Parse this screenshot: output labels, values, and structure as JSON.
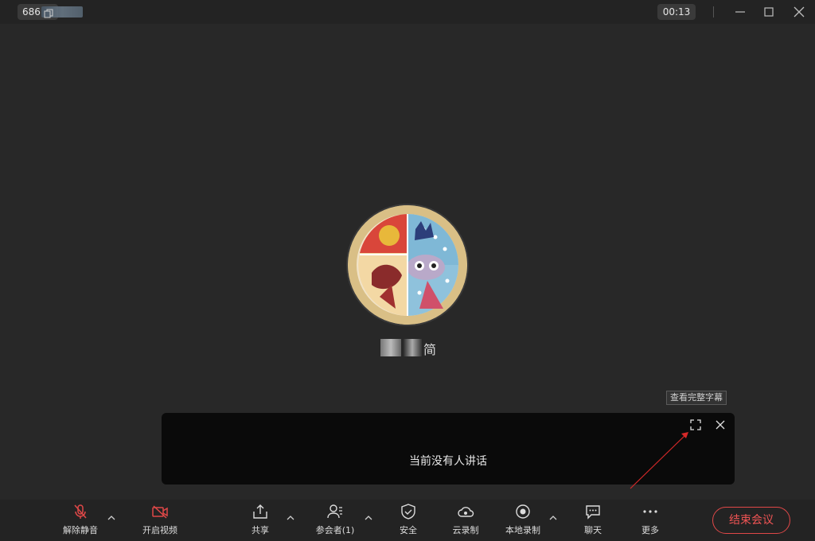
{
  "titlebar": {
    "meeting_id": "686",
    "timer": "00:13"
  },
  "profile": {
    "name_visible": "简"
  },
  "captions": {
    "full_captions_button": "查看完整字幕",
    "status_text": "当前没有人讲话"
  },
  "toolbar": {
    "unmute": "解除静音",
    "start_video": "开启视频",
    "share": "共享",
    "participants": "参会者(1)",
    "security": "安全",
    "cloud_record": "云录制",
    "local_record": "本地录制",
    "chat": "聊天",
    "more": "更多",
    "end_meeting": "结束会议"
  },
  "colors": {
    "danger": "#e04848",
    "background": "#282828",
    "bar": "#232323",
    "caption_panel": "#0a0a0a"
  }
}
